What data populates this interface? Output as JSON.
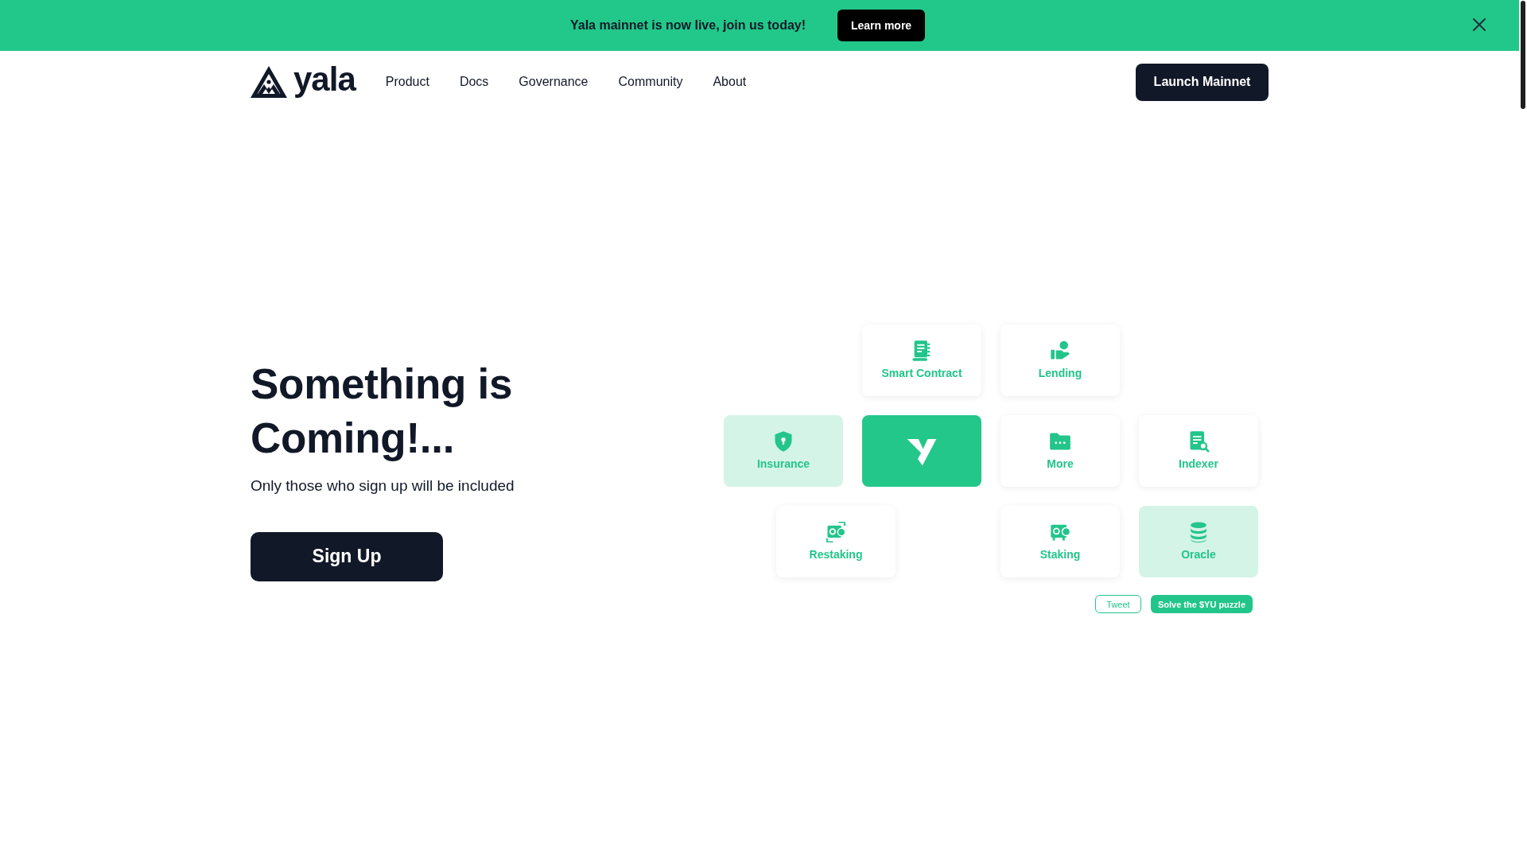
{
  "banner": {
    "text": "Yala mainnet is now live, join us today!",
    "button": "Learn more"
  },
  "nav": {
    "brand": "yala",
    "links": [
      "Product",
      "Docs",
      "Governance",
      "Community",
      "About"
    ],
    "button": "Launch Mainnet"
  },
  "hero": {
    "title": "Something is Coming!...",
    "subtitle": "Only those who sign up will be included",
    "button": "Sign Up"
  },
  "tiles": [
    {
      "kind": "feature",
      "label": "Smart Contract",
      "highlighted": false
    },
    {
      "kind": "feature",
      "label": "Lending",
      "highlighted": false
    },
    {
      "kind": "feature",
      "label": "Insurance",
      "highlighted": true
    },
    {
      "kind": "logo",
      "highlighted": false
    },
    {
      "kind": "feature",
      "label": "More",
      "highlighted": false
    },
    {
      "kind": "feature",
      "label": "Indexer",
      "highlighted": false
    },
    {
      "kind": "feature",
      "label": "Restaking",
      "highlighted": false
    },
    {
      "kind": "feature",
      "label": "Staking",
      "highlighted": false
    },
    {
      "kind": "feature",
      "label": "Oracle",
      "highlighted": true
    }
  ],
  "actions": [
    {
      "kind": "outline",
      "label": "Tweet"
    },
    {
      "kind": "filled",
      "label": "Solve the $YU puzzle"
    }
  ]
}
